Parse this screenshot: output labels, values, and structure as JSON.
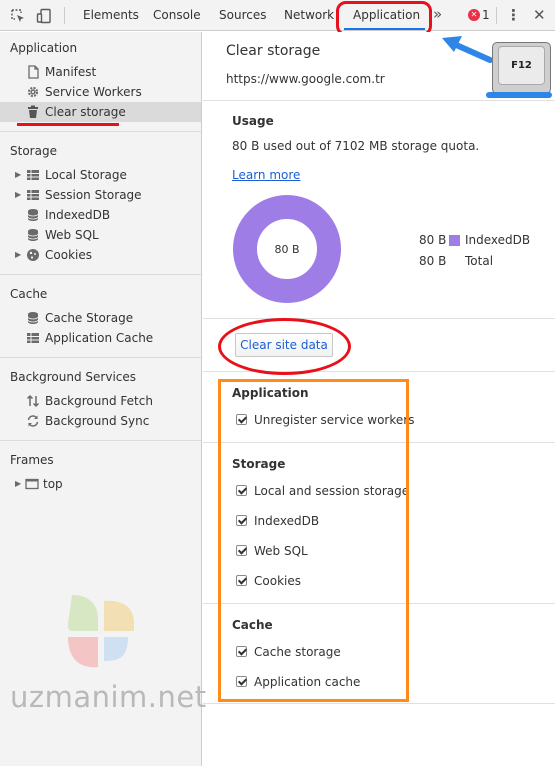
{
  "toolbar": {
    "tabs": [
      {
        "label": "Elements"
      },
      {
        "label": "Console"
      },
      {
        "label": "Sources"
      },
      {
        "label": "Network"
      },
      {
        "label": "Application"
      }
    ],
    "more_label": "»",
    "error_count": "1",
    "kebab_label": "⋮",
    "close_label": "✕",
    "active_tab": "Application"
  },
  "sidebar": {
    "sections": [
      {
        "title": "Application",
        "items": [
          {
            "label": "Manifest",
            "icon": "file-icon"
          },
          {
            "label": "Service Workers",
            "icon": "gear-icon"
          },
          {
            "label": "Clear storage",
            "icon": "trash-icon",
            "selected": true
          }
        ]
      },
      {
        "title": "Storage",
        "items": [
          {
            "label": "Local Storage",
            "icon": "grid-icon",
            "expandable": true
          },
          {
            "label": "Session Storage",
            "icon": "grid-icon",
            "expandable": true
          },
          {
            "label": "IndexedDB",
            "icon": "database-icon"
          },
          {
            "label": "Web SQL",
            "icon": "database-icon"
          },
          {
            "label": "Cookies",
            "icon": "cookie-icon",
            "expandable": true
          }
        ]
      },
      {
        "title": "Cache",
        "items": [
          {
            "label": "Cache Storage",
            "icon": "database-icon"
          },
          {
            "label": "Application Cache",
            "icon": "grid-icon"
          }
        ]
      },
      {
        "title": "Background Services",
        "items": [
          {
            "label": "Background Fetch",
            "icon": "arrows-updown-icon"
          },
          {
            "label": "Background Sync",
            "icon": "sync-icon"
          }
        ]
      },
      {
        "title": "Frames",
        "items": [
          {
            "label": "top",
            "icon": "frame-icon",
            "expandable": true
          }
        ]
      }
    ]
  },
  "main": {
    "title": "Clear storage",
    "url": "https://www.google.com.tr",
    "usage": {
      "heading": "Usage",
      "text": "80 B used out of 7102 MB storage quota.",
      "learn_more": "Learn more",
      "donut_label": "80 B",
      "legend": [
        {
          "value": "80 B",
          "name": "IndexedDB",
          "color": "#9e7de6"
        },
        {
          "value": "80 B",
          "name": "Total",
          "color": ""
        }
      ]
    },
    "clear_button": "Clear site data",
    "groups": [
      {
        "heading": "Application",
        "options": [
          {
            "label": "Unregister service workers",
            "checked": true
          }
        ]
      },
      {
        "heading": "Storage",
        "options": [
          {
            "label": "Local and session storage",
            "checked": true
          },
          {
            "label": "IndexedDB",
            "checked": true
          },
          {
            "label": "Web SQL",
            "checked": true
          },
          {
            "label": "Cookies",
            "checked": true
          }
        ]
      },
      {
        "heading": "Cache",
        "options": [
          {
            "label": "Cache storage",
            "checked": true
          },
          {
            "label": "Application cache",
            "checked": true
          }
        ]
      }
    ]
  },
  "overlay": {
    "key_label": "F12",
    "watermark": "uzmanim.net"
  },
  "colors": {
    "annotation_red": "#e8101a",
    "annotation_orange": "#ff8c1a",
    "annotation_blue": "#2d86e8",
    "donut": "#9e7de6",
    "link": "#1a5fd6"
  }
}
